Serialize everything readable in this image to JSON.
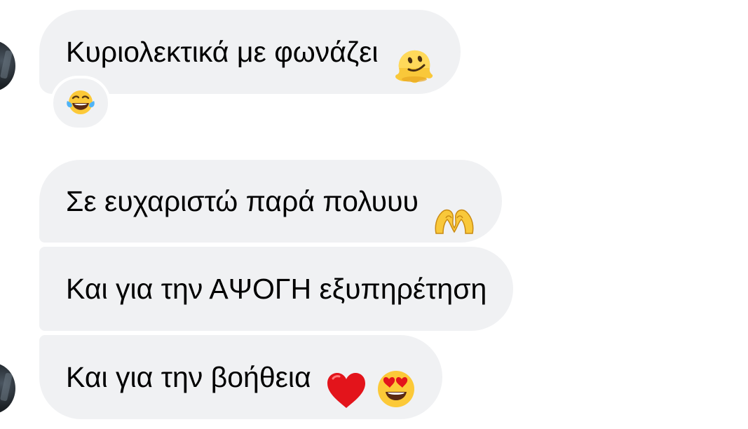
{
  "messages": [
    {
      "text": "Κυριολεκτικά με φωνάζει",
      "emoji": [
        "melting-face"
      ],
      "reaction": "face-with-tears-of-joy"
    },
    {
      "text": "Σε ευχαριστώ παρά πολυυυ",
      "emoji": [
        "heart-hands"
      ]
    },
    {
      "text": "Και για την ΑΨΟΓΗ εξυπηρέτηση",
      "emoji": []
    },
    {
      "text": "Και για την βοήθεια",
      "emoji": [
        "red-heart",
        "smiling-face-with-heart-eyes"
      ]
    }
  ],
  "colors": {
    "bubble_background": "#f0f1f3",
    "text": "#000000",
    "page_background": "#ffffff"
  }
}
